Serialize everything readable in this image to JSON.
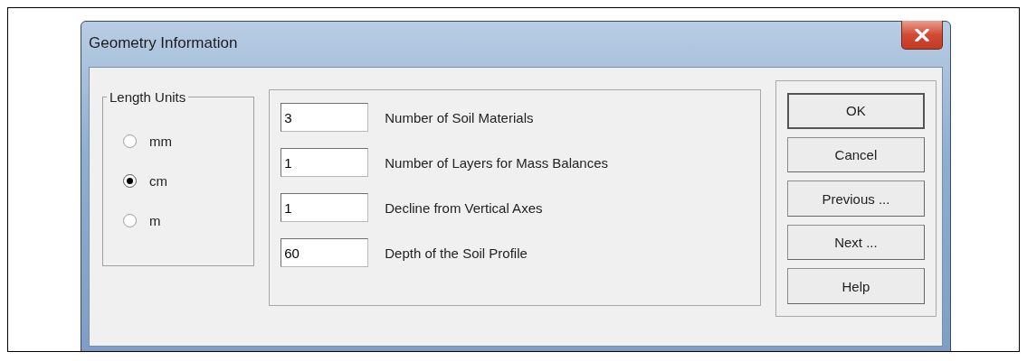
{
  "window": {
    "title": "Geometry Information"
  },
  "length_units": {
    "title": "Length Units",
    "options": [
      {
        "label": "mm",
        "selected": false
      },
      {
        "label": "cm",
        "selected": true
      },
      {
        "label": "m",
        "selected": false
      }
    ]
  },
  "fields": [
    {
      "value": "3",
      "label": "Number of Soil Materials"
    },
    {
      "value": "1",
      "label": "Number of Layers for Mass Balances"
    },
    {
      "value": "1",
      "label": "Decline from Vertical Axes"
    },
    {
      "value": "60",
      "label": "Depth of the Soil Profile"
    }
  ],
  "buttons": [
    "OK",
    "Cancel",
    "Previous ...",
    "Next ...",
    "Help"
  ]
}
